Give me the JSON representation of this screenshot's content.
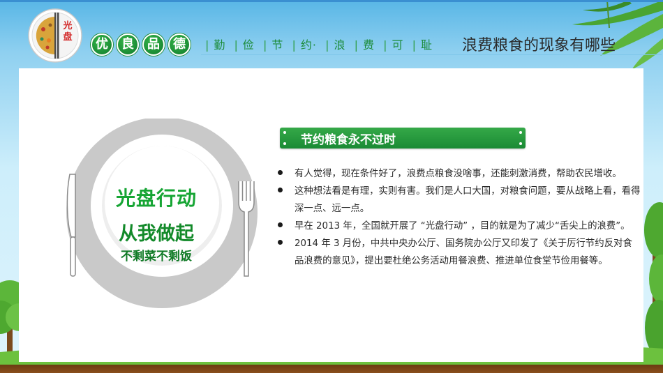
{
  "header": {
    "logo_text": "光盘",
    "badges": [
      "优",
      "良",
      "品",
      "德"
    ],
    "motto": [
      "勤",
      "俭",
      "节",
      "约·",
      "浪",
      "费",
      "可",
      "耻"
    ],
    "title": "浪费粮食的现象有哪些"
  },
  "plate": {
    "slogan_line1": "光盘行动",
    "slogan_line2": "从我做起",
    "slogan_line3": "不剩菜不剩饭"
  },
  "section": {
    "heading": "节约粮食永不过时",
    "bullets": [
      "有人觉得，现在条件好了，浪费点粮食没啥事，还能刺激消费，帮助农民增收。",
      "这种想法看是有理，实则有害。我们是人口大国，对粮食问题，要从战略上看，看得深一点、远一点。",
      "早在 2013 年，全国就开展了 “光盘行动” ，目的就是为了减少“舌尖上的浪费”。",
      "2014 年 3 月份，中共中央办公厅、国务院办公厅又印发了《关于厉行节约反对食品浪费的意见》，提出要杜绝公务活动用餐浪费、推进单位食堂节俭用餐等。"
    ]
  },
  "colors": {
    "accent_green": "#1d8a36",
    "sky_blue": "#58b6e6",
    "ground_brown": "#6b3b12"
  }
}
